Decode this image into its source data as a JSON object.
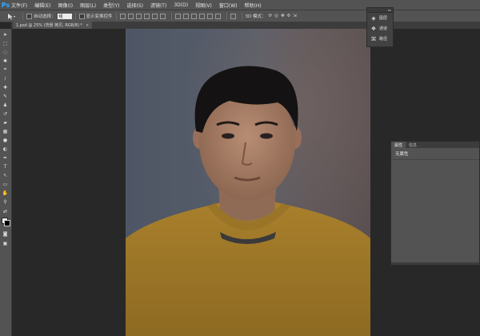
{
  "app": {
    "logo": "Ps"
  },
  "menu": [
    "文件(F)",
    "编辑(E)",
    "图像(I)",
    "图层(L)",
    "类型(Y)",
    "选择(S)",
    "滤镜(T)",
    "3D(D)",
    "视图(V)",
    "窗口(W)",
    "帮助(H)"
  ],
  "options": {
    "auto_select_label": "自动选择：",
    "auto_select_value": "组",
    "transform_label": "显示变换控件",
    "mode_3d_label": "3D 模式："
  },
  "document_tab": {
    "title": "1.psd @ 25% (背景 拷贝, RGB/8) *",
    "close": "×"
  },
  "panels": {
    "layers": "图层",
    "channels": "通道",
    "paths": "路径",
    "grip": "▸▸"
  },
  "properties": {
    "tabs": [
      "属性",
      "信息"
    ],
    "body": "无属性"
  },
  "icons": {
    "tools": [
      "move-icon",
      "marquee-icon",
      "lasso-icon",
      "magic-wand-icon",
      "crop-icon",
      "eyedropper-icon",
      "healing-icon",
      "brush-icon",
      "stamp-icon",
      "history-brush-icon",
      "eraser-icon",
      "gradient-icon",
      "blur-icon",
      "dodge-icon",
      "pen-icon",
      "type-icon",
      "path-select-icon",
      "shape-icon",
      "hand-icon",
      "zoom-icon"
    ]
  }
}
